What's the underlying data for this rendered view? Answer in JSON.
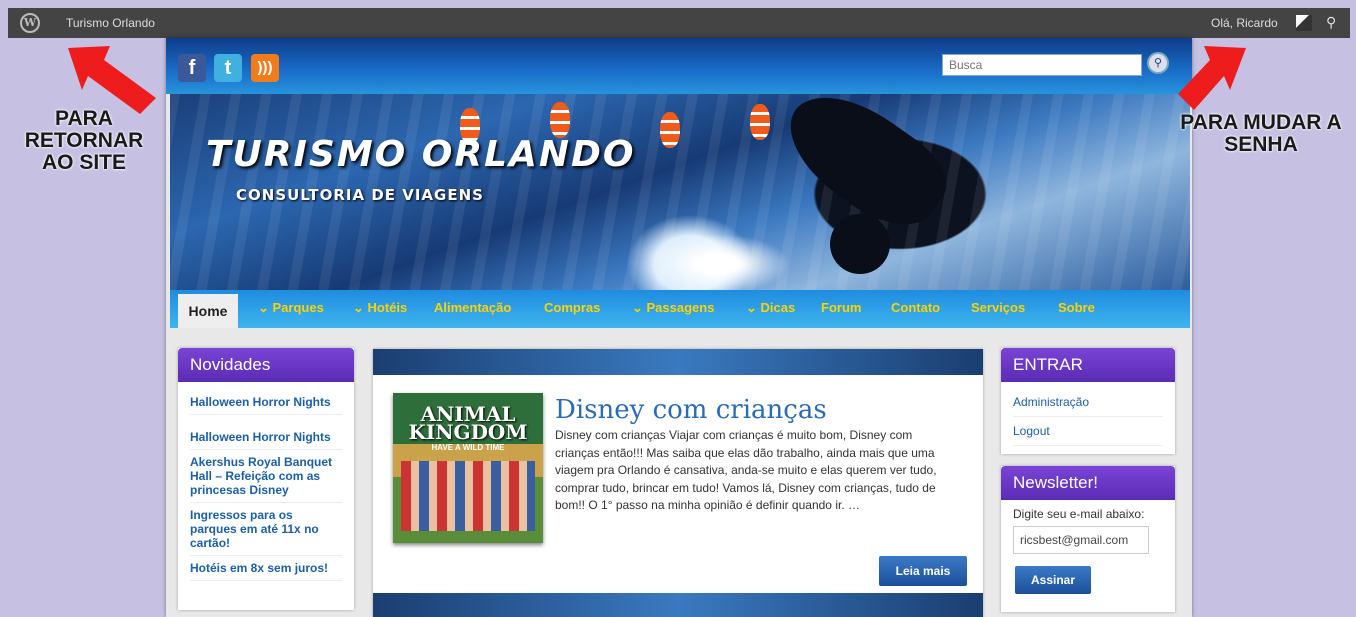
{
  "admin_bar": {
    "site_name": "Turismo Orlando",
    "greeting": "Olá, Ricardo"
  },
  "header": {
    "search_placeholder": "Busca",
    "social": [
      "facebook-icon",
      "twitter-icon",
      "rss-icon"
    ],
    "banner_title": "TURISMO ORLANDO",
    "banner_subtitle": "CONSULTORIA DE VIAGENS"
  },
  "nav": {
    "home": "Home",
    "items": [
      "⌄ Parques",
      "⌄ Hotéis",
      "Alimentação",
      "Compras",
      "⌄ Passagens",
      "⌄ Dicas",
      "Forum",
      "Contato",
      "Serviços",
      "Sobre"
    ]
  },
  "novidades": {
    "title": "Novidades",
    "items": [
      "Halloween Horror Nights",
      "Halloween Horror Nights",
      "Akershus Royal Banquet Hall – Refeição com as princesas Disney",
      "Ingressos para os parques em até 11x no cartão!",
      "Hotéis em 8x sem juros!"
    ]
  },
  "post": {
    "thumb_title": "ANIMAL KINGDOM",
    "thumb_tag": "HAVE A WILD TIME",
    "title": "Disney com crianças",
    "excerpt": "Disney com crianças Viajar com crianças é muito bom, Disney com crianças então!!! Mas saiba que elas dão trabalho, ainda mais que uma viagem pra Orlando é cansativa, anda-se muito e elas querem ver tudo, comprar tudo, brincar em tudo! Vamos lá, Disney com crianças, tudo de bom!! O 1° passo na minha opinião é definir quando ir. …",
    "read_more": "Leia mais"
  },
  "entrar": {
    "title": "ENTRAR",
    "links": [
      "Administração",
      "Logout"
    ]
  },
  "newsletter": {
    "title": "Newsletter!",
    "label": "Digite seu e-mail abaixo:",
    "email_value": "ricsbest@gmail.com",
    "button": "Assinar"
  },
  "annotations": {
    "left": "PARA RETORNAR AO SITE",
    "right": "PARA MUDAR A SENHA",
    "accent_color": "#ee1c1c"
  }
}
